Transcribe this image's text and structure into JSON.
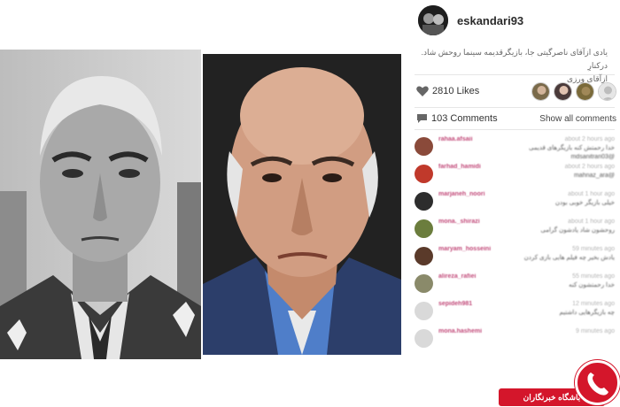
{
  "post": {
    "username": "eskandari93",
    "caption_lines": [
      "یادی ازآقای ناصرگیتی جا، بازیگرقدیمه سینما روحش شاد. درکنارِ",
      "ازآقای ورزی"
    ]
  },
  "likes": {
    "text": "2810 Likes"
  },
  "comments_header": {
    "count_text": "103 Comments",
    "show_all": "Show all comments"
  },
  "comments": [
    {
      "user": "rahaa.afsaii",
      "time": "about 2 hours ago",
      "line1": "خدا رحمتش کنه بازیگرهای قدیمی",
      "line2": "@mdsanitrari03",
      "color": "#8a4a3a"
    },
    {
      "user": "farhad_hamidi",
      "time": "about 2 hours ago",
      "line1": "@mahnaz_ara",
      "line2": "",
      "color": "#c0392b"
    },
    {
      "user": "marjaneh_noori",
      "time": "about 1 hour ago",
      "line1": "خیلی بازیگر خوبی بودن",
      "line2": "",
      "color": "#2d2d2d"
    },
    {
      "user": "mona._shirazi",
      "time": "about 1 hour ago",
      "line1": "روحشون شاد یادشون گرامی",
      "line2": "",
      "color": "#6b7d3d"
    },
    {
      "user": "maryam_hosseini",
      "time": "59 minutes ago",
      "line1": "یادش بخیر چه فیلم هایی بازی کردن",
      "line2": "",
      "color": "#5a3a2a"
    },
    {
      "user": "alireza_rafiei",
      "time": "55 minutes ago",
      "line1": "خدا رحمتشون کنه",
      "line2": "",
      "color": "#8a8a6a"
    },
    {
      "user": "sepideh981",
      "time": "12 minutes ago",
      "line1": "چه بازیگرهایی داشتیم",
      "line2": "",
      "color": "#d9d9d9"
    },
    {
      "user": "mona.hashemi",
      "time": "9 minutes ago",
      "line1": "",
      "line2": "",
      "color": "#d9d9d9"
    }
  ],
  "likers": [
    {
      "name": "liker-1",
      "color": "#7a6a4a"
    },
    {
      "name": "liker-2",
      "color": "#4a3a3a"
    },
    {
      "name": "liker-3",
      "color": "#7a6a3a"
    },
    {
      "name": "liker-4",
      "color": "#e6e6e6"
    }
  ],
  "watermark": {
    "text": "باشگاه خبرنگاران"
  },
  "colors": {
    "accent": "#d4162b",
    "username": "#c24b7a"
  }
}
